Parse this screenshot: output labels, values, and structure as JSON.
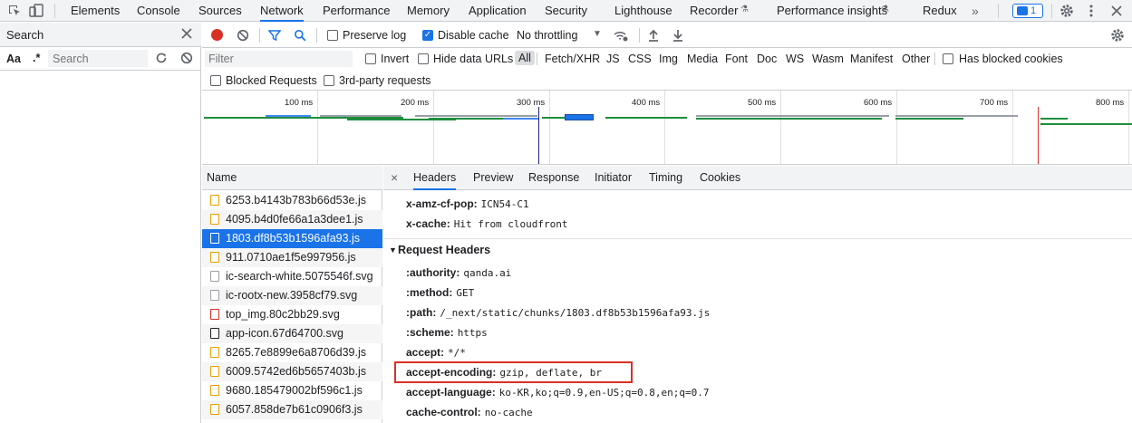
{
  "devtools": {
    "top_tabs": [
      "Elements",
      "Console",
      "Sources",
      "Network",
      "Performance",
      "Memory",
      "Application",
      "Security",
      "Lighthouse",
      "Recorder",
      "Performance insights",
      "Redux"
    ],
    "active_tab": "Network",
    "more_tabs": "»",
    "issues_count": "1"
  },
  "search_panel": {
    "title": "Search",
    "aa_label": "Aa",
    "regex_label": ".*",
    "placeholder": "Search"
  },
  "network": {
    "preserve_log": "Preserve log",
    "disable_cache": "Disable cache",
    "throttling": "No throttling",
    "filter_placeholder": "Filter",
    "invert": "Invert",
    "hide_data_urls": "Hide data URLs",
    "type_filters": [
      "All",
      "Fetch/XHR",
      "JS",
      "CSS",
      "Img",
      "Media",
      "Font",
      "Doc",
      "WS",
      "Wasm",
      "Manifest",
      "Other"
    ],
    "has_blocked_cookies": "Has blocked cookies",
    "blocked_requests": "Blocked Requests",
    "third_party": "3rd-party requests",
    "timeline_ticks": [
      "100 ms",
      "200 ms",
      "300 ms",
      "400 ms",
      "500 ms",
      "600 ms",
      "700 ms",
      "800 ms"
    ]
  },
  "requests": {
    "header": "Name",
    "files": [
      {
        "name": "6253.b4143b783b66d53e.js",
        "kind": "js"
      },
      {
        "name": "4095.b4d0fe66a1a3dee1.js",
        "kind": "js"
      },
      {
        "name": "1803.df8b53b1596afa93.js",
        "kind": "js",
        "selected": true
      },
      {
        "name": "911.0710ae1f5e997956.js",
        "kind": "js"
      },
      {
        "name": "ic-search-white.5075546f.svg",
        "kind": "svg"
      },
      {
        "name": "ic-rootx-new.3958cf79.svg",
        "kind": "svg"
      },
      {
        "name": "top_img.80c2bb29.svg",
        "kind": "img"
      },
      {
        "name": "app-icon.67d64700.svg",
        "kind": "dark"
      },
      {
        "name": "8265.7e8899e6a8706d39.js",
        "kind": "js"
      },
      {
        "name": "6009.5742ed6b5657403b.js",
        "kind": "js"
      },
      {
        "name": "9680.185479002bf596c1.js",
        "kind": "js"
      },
      {
        "name": "6057.858de7b61c0906f3.js",
        "kind": "js"
      }
    ]
  },
  "details": {
    "close": "×",
    "tabs": [
      "Headers",
      "Preview",
      "Response",
      "Initiator",
      "Timing",
      "Cookies"
    ],
    "active_tab": "Headers",
    "response_tail": [
      {
        "key": "x-amz-cf-pop:",
        "value": "ICN54-C1"
      },
      {
        "key": "x-cache:",
        "value": "Hit from cloudfront"
      }
    ],
    "request_headers_title": "Request Headers",
    "request_headers": [
      {
        "key": ":authority:",
        "value": "qanda.ai"
      },
      {
        "key": ":method:",
        "value": "GET"
      },
      {
        "key": ":path:",
        "value": "/_next/static/chunks/1803.df8b53b1596afa93.js"
      },
      {
        "key": ":scheme:",
        "value": "https"
      },
      {
        "key": "accept:",
        "value": "*/*"
      },
      {
        "key": "accept-encoding:",
        "value": "gzip, deflate, br",
        "highlighted": true
      },
      {
        "key": "accept-language:",
        "value": "ko-KR,ko;q=0.9,en-US;q=0.8,en;q=0.7"
      },
      {
        "key": "cache-control:",
        "value": "no-cache"
      }
    ]
  },
  "colors": {
    "accent": "#1a73e8",
    "record": "#d93025",
    "highlight_box": "#d93025"
  }
}
